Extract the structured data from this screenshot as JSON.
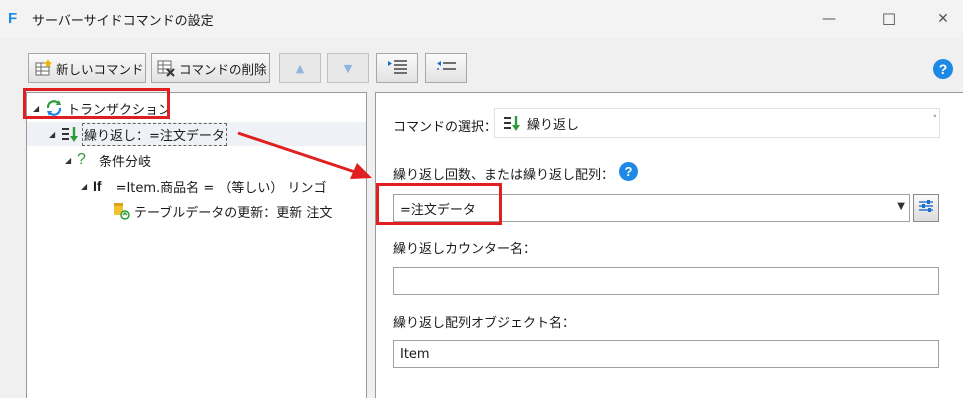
{
  "window": {
    "title": "サーバーサイドコマンドの設定",
    "app_icon_letter": "F",
    "min_glyph": "—",
    "max_glyph": "☐",
    "close_glyph": "✕"
  },
  "toolbar": {
    "new_command": "新しいコマンド",
    "delete_command": "コマンドの削除",
    "move_up_glyph": "▲",
    "move_down_glyph": "▼",
    "help": "?"
  },
  "tree": {
    "transaction": "トランザクション",
    "repeat": "繰り返し：=注文データ",
    "branch": "条件分岐",
    "if_keyword": "If",
    "if_condition": "=Item.商品名 = （等しい） リンゴ",
    "update": "テーブルデータの更新：更新 注文"
  },
  "form": {
    "command_select_label": "コマンドの選択：",
    "command_select_value": "繰り返し",
    "repeat_count_label": "繰り返し回数、または繰り返し配列：",
    "repeat_count_value": "=注文データ",
    "counter_name_label": "繰り返しカウンター名：",
    "counter_name_value": "",
    "array_object_label": "繰り返し配列オブジェクト名：",
    "array_object_value": "Item",
    "help": "?"
  },
  "colors": {
    "accent_blue": "#1e88e5",
    "highlight_red": "#e02020",
    "green": "#2e9b3a"
  }
}
